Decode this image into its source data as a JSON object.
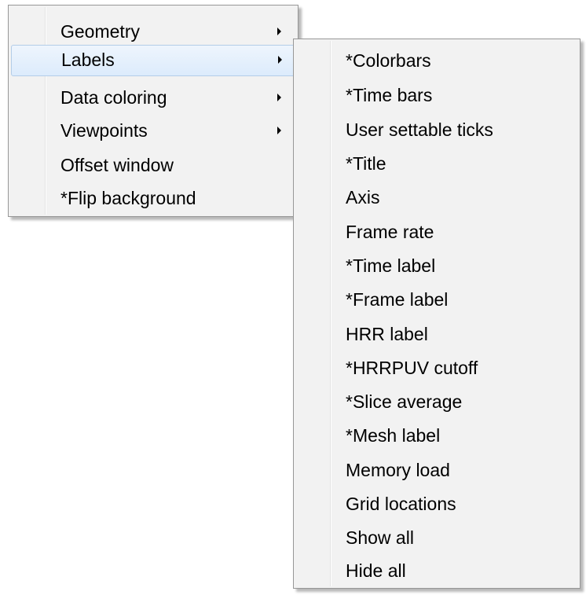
{
  "main_menu": {
    "items": [
      {
        "label": "Geometry",
        "has_submenu": true
      },
      {
        "label": "Labels",
        "has_submenu": true,
        "highlighted": true
      },
      {
        "label": "Data coloring",
        "has_submenu": true
      },
      {
        "label": "Viewpoints",
        "has_submenu": true
      },
      {
        "label": "Offset window",
        "has_submenu": false
      },
      {
        "label": "*Flip background",
        "has_submenu": false
      }
    ]
  },
  "labels_submenu": {
    "items": [
      {
        "label": "*Colorbars"
      },
      {
        "label": "*Time bars"
      },
      {
        "label": "User settable ticks"
      },
      {
        "label": "*Title"
      },
      {
        "label": "Axis"
      },
      {
        "label": "Frame rate"
      },
      {
        "label": "*Time label"
      },
      {
        "label": "*Frame label"
      },
      {
        "label": "HRR label"
      },
      {
        "label": "*HRRPUV cutoff"
      },
      {
        "label": "*Slice average"
      },
      {
        "label": "*Mesh label"
      },
      {
        "label": "Memory load"
      },
      {
        "label": "Grid locations"
      },
      {
        "label": "Show all"
      },
      {
        "label": "Hide all"
      }
    ]
  },
  "icons": {
    "submenu_arrow": "chevron-right-icon"
  }
}
